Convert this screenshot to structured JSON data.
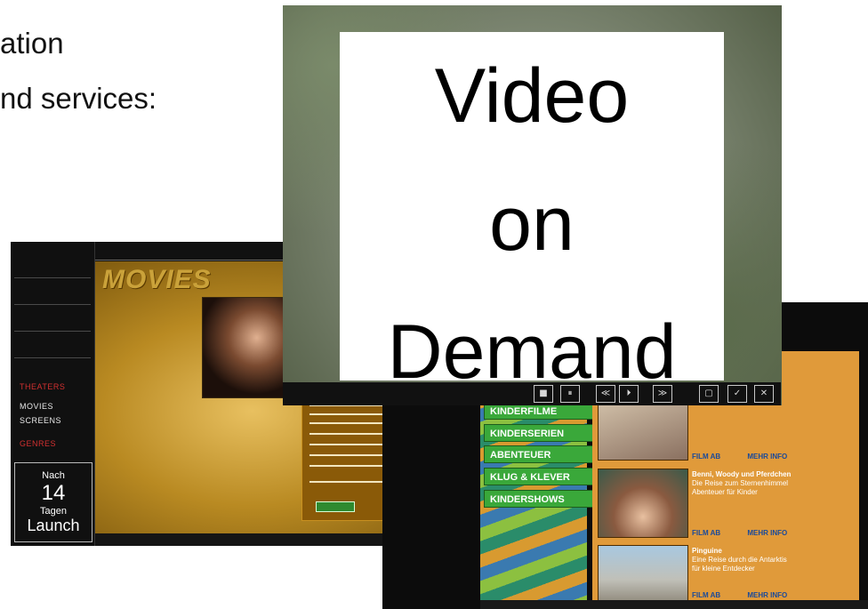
{
  "slide": {
    "line1": "ation",
    "line2": "nd services:"
  },
  "vod": {
    "title": "Video\non\nDemand"
  },
  "movies_portal": {
    "title": "MOVIES",
    "side_items": [
      "THEATERS",
      "MOVIES",
      "SCREENS",
      "GENRES"
    ],
    "launch": {
      "line1": "Nach",
      "number": "14",
      "line2": "Tagen",
      "line3": "Launch"
    }
  },
  "kids_portal": {
    "menu": [
      "KINDERFILME",
      "KINDERSERIEN",
      "ABENTEUER",
      "KLUG & KLEVER",
      "KINDERSHOWS"
    ],
    "cards": [
      {
        "title": "",
        "lines": [
          "",
          ""
        ],
        "btn1": "FILM AB",
        "btn2": "MEHR INFO"
      },
      {
        "title": "Benni, Woody und Pferdchen",
        "lines": [
          "Die Reise zum Sternenhimmel",
          "Abenteuer für Kinder"
        ],
        "btn1": "FILM AB",
        "btn2": "MEHR INFO"
      },
      {
        "title": "Pinguine",
        "lines": [
          "Eine Reise durch die Antarktis",
          "für kleine Entdecker"
        ],
        "btn1": "FILM AB",
        "btn2": "MEHR INFO"
      }
    ]
  },
  "controls": [
    "■",
    "⏸",
    "≪",
    "⏵",
    "≫",
    "▢",
    "✓",
    "✕"
  ],
  "colors": {
    "gold": "#b98a22",
    "orange_panel": "#e09a3a",
    "menu_green": "#3aa83a"
  }
}
